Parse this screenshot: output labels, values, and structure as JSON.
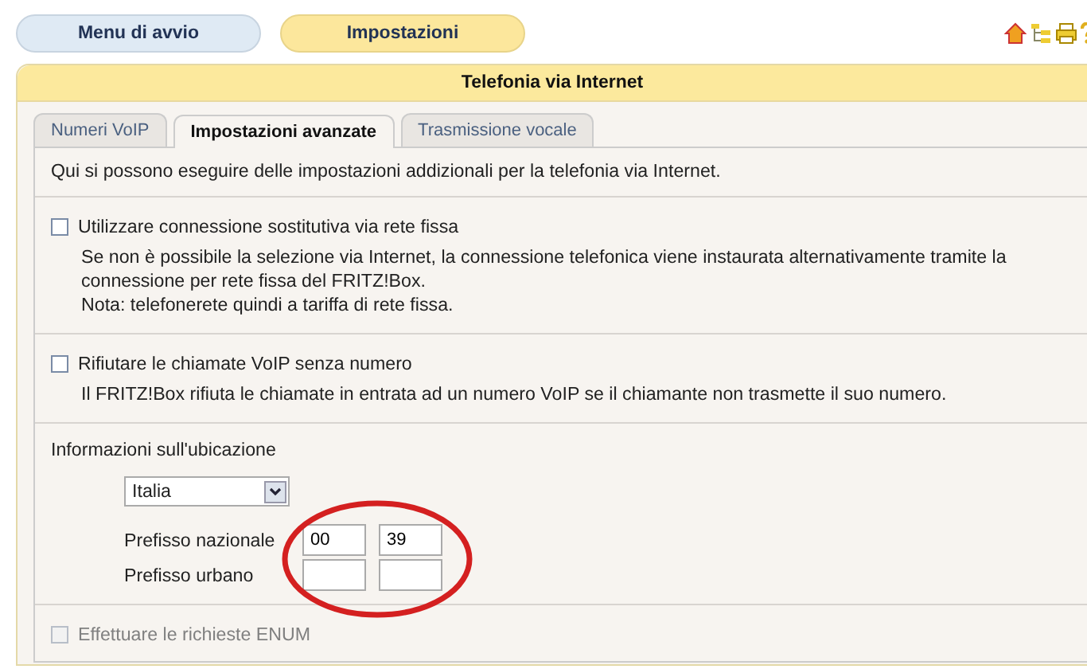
{
  "nav_buttons": [
    {
      "label": "Menu di avvio",
      "selected": false
    },
    {
      "label": "Impostazioni",
      "selected": true
    }
  ],
  "panel": {
    "title": "Telefonia via Internet"
  },
  "tabs": [
    {
      "label": "Numeri VoIP",
      "selected": false
    },
    {
      "label": "Impostazioni avanzate",
      "selected": true
    },
    {
      "label": "Trasmissione vocale",
      "selected": false
    }
  ],
  "intro": "Qui si possono eseguire delle impostazioni addizionali per la telefonia via Internet.",
  "options": [
    {
      "label": "Utilizzare connessione sostitutiva via rete fissa",
      "checked": false,
      "disabled": false,
      "description": [
        "Se non è possibile la selezione via Internet, la connessione telefonica viene instaurata alternativamente tramite la connessione per rete fissa del FRITZ!Box.",
        "Nota: telefonerete quindi a tariffa di rete fissa."
      ]
    },
    {
      "label": "Rifiutare le chiamate VoIP senza numero",
      "checked": false,
      "disabled": false,
      "description": [
        "Il FRITZ!Box rifiuta le chiamate in entrata ad un numero VoIP se il chiamante non trasmette il suo numero."
      ]
    }
  ],
  "location": {
    "title": "Informazioni sull'ubicazione",
    "country": "Italia",
    "fields": [
      {
        "label": "Prefisso nazionale",
        "values": [
          "00",
          "39"
        ]
      },
      {
        "label": "Prefisso urbano"
      }
    ]
  },
  "enum_option": {
    "label": "Effettuare le richieste ENUM",
    "checked": false,
    "disabled": true
  }
}
